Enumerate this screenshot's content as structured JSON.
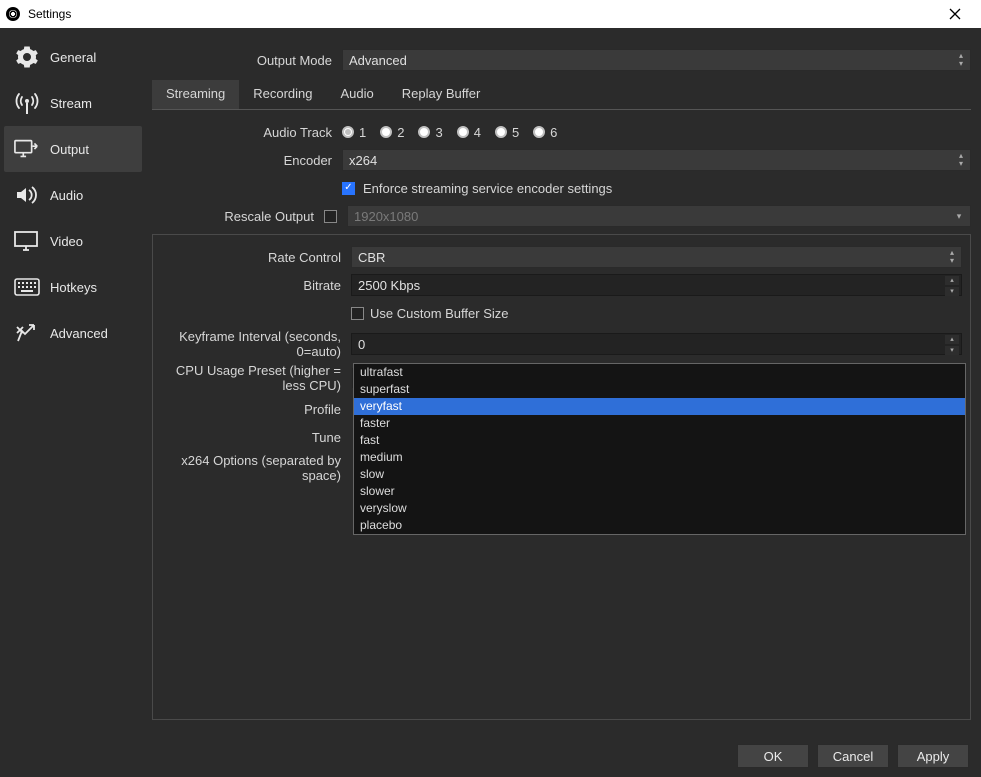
{
  "window": {
    "title": "Settings"
  },
  "sidebar": {
    "items": [
      {
        "label": "General"
      },
      {
        "label": "Stream"
      },
      {
        "label": "Output"
      },
      {
        "label": "Audio"
      },
      {
        "label": "Video"
      },
      {
        "label": "Hotkeys"
      },
      {
        "label": "Advanced"
      }
    ]
  },
  "output_mode": {
    "label": "Output Mode",
    "value": "Advanced"
  },
  "tabs": {
    "streaming": "Streaming",
    "recording": "Recording",
    "audio": "Audio",
    "replay": "Replay Buffer"
  },
  "audio_track": {
    "label": "Audio Track",
    "options": [
      "1",
      "2",
      "3",
      "4",
      "5",
      "6"
    ],
    "selected_index": 0
  },
  "encoder": {
    "label": "Encoder",
    "value": "x264"
  },
  "enforce": {
    "label": "Enforce streaming service encoder settings",
    "checked": true
  },
  "rescale": {
    "label": "Rescale Output",
    "checked": false,
    "placeholder": "1920x1080"
  },
  "rate_control": {
    "label": "Rate Control",
    "value": "CBR"
  },
  "bitrate": {
    "label": "Bitrate",
    "value": "2500 Kbps"
  },
  "custom_buffer": {
    "label": "Use Custom Buffer Size",
    "checked": false
  },
  "keyframe": {
    "label": "Keyframe Interval (seconds, 0=auto)",
    "value": "0"
  },
  "cpu_preset": {
    "label": "CPU Usage Preset (higher = less CPU)",
    "value": "veryfast",
    "options": [
      "ultrafast",
      "superfast",
      "veryfast",
      "faster",
      "fast",
      "medium",
      "slow",
      "slower",
      "veryslow",
      "placebo"
    ],
    "selected": "veryfast"
  },
  "profile": {
    "label": "Profile"
  },
  "tune": {
    "label": "Tune"
  },
  "x264_options": {
    "label": "x264 Options (separated by space)"
  },
  "buttons": {
    "ok": "OK",
    "cancel": "Cancel",
    "apply": "Apply"
  }
}
